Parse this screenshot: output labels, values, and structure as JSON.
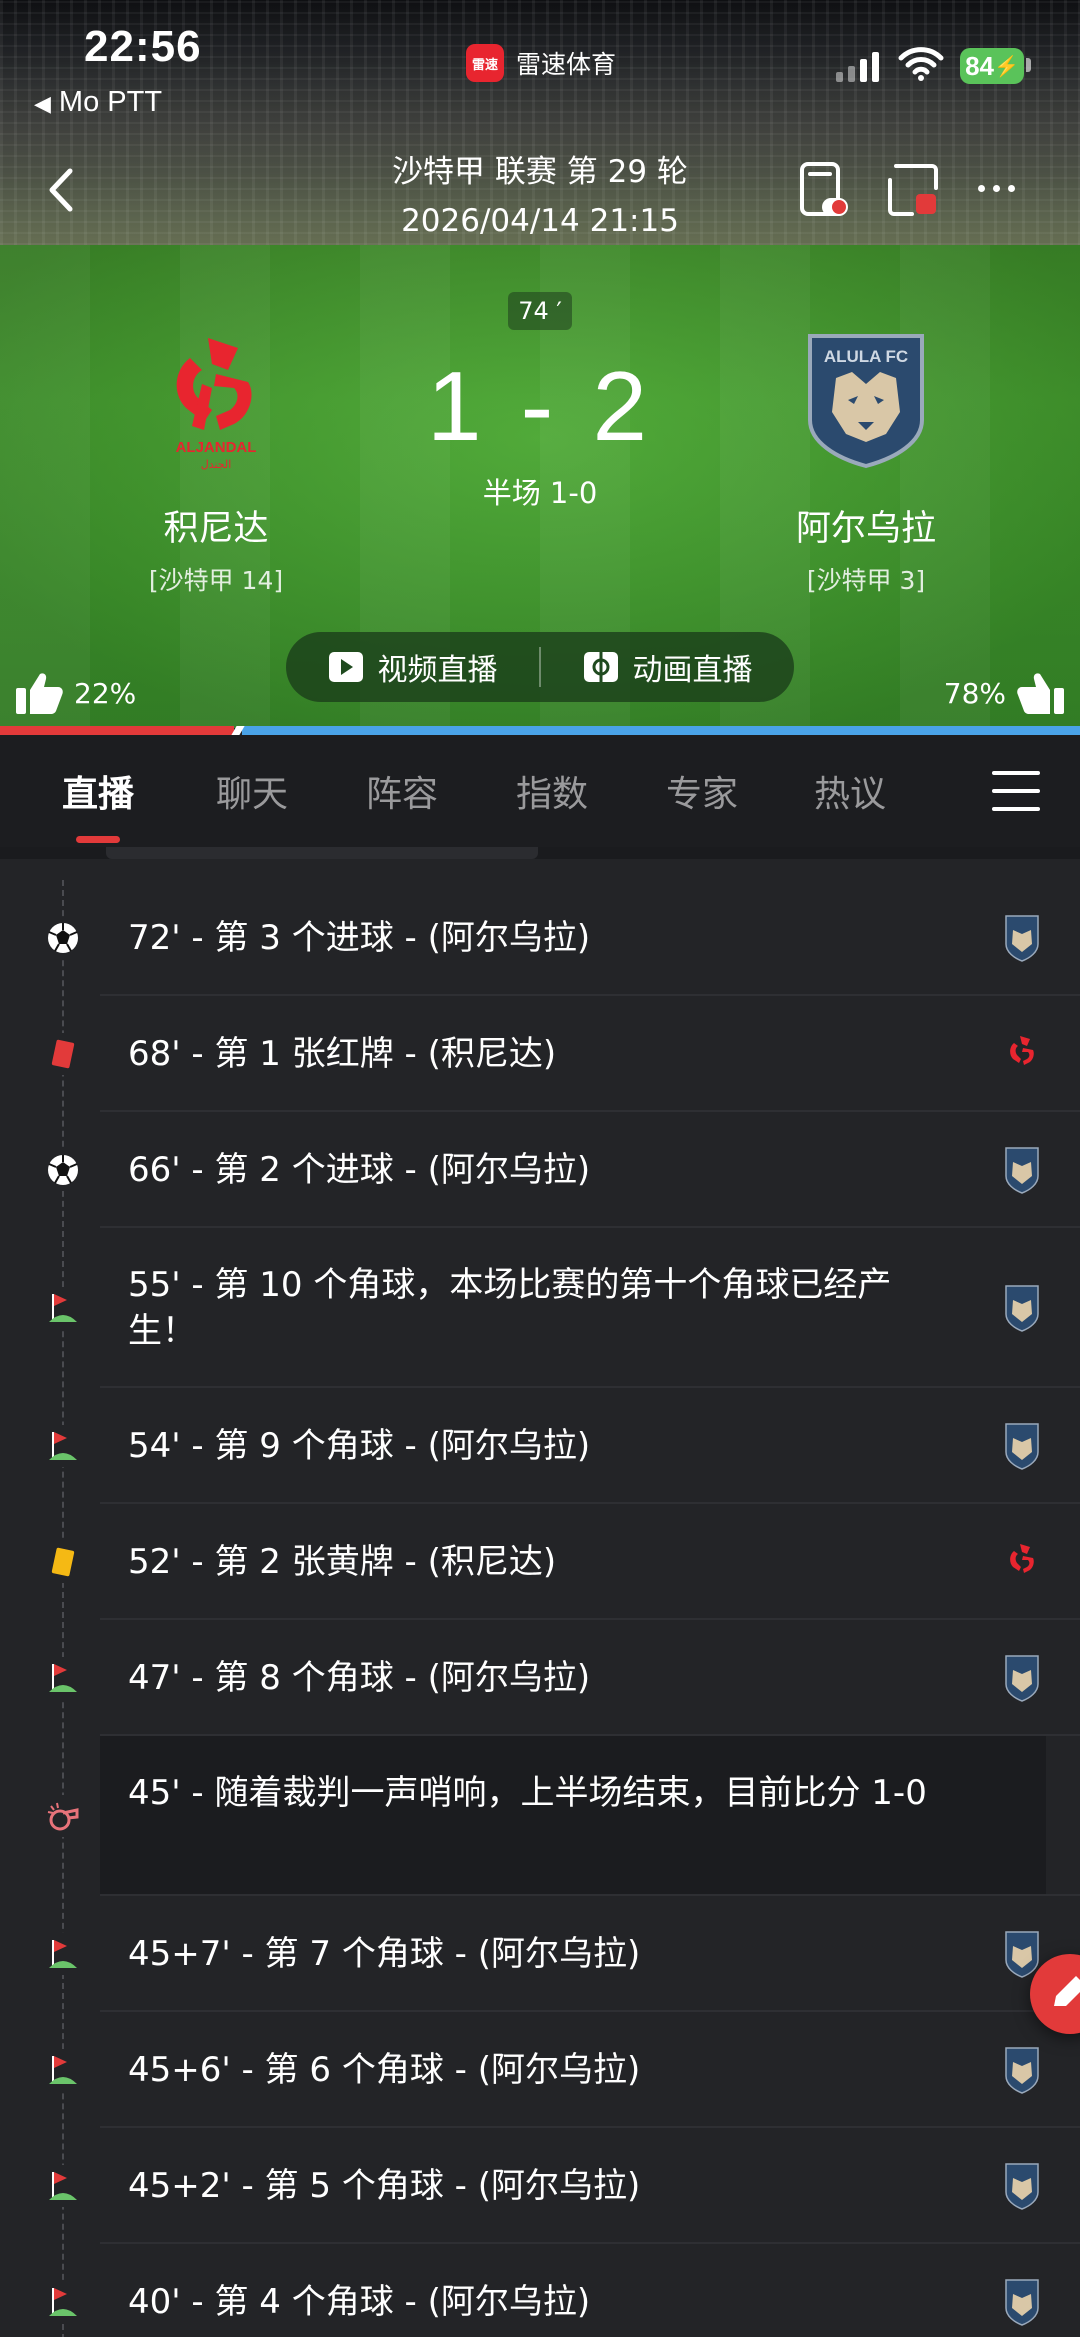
{
  "status": {
    "time": "22:56",
    "back_app": "Mo PTT",
    "app_name": "雷速体育",
    "app_logo_text": "雷速",
    "battery": "84"
  },
  "header": {
    "league_round": "沙特甲 联赛 第 29 轮",
    "datetime": "2026/04/14 21:15",
    "minute": "74 ′",
    "score": "1 - 2",
    "halftime": "半场 1-0"
  },
  "home": {
    "name": "积尼达",
    "rank": "[沙特甲 14]",
    "logo_text": "ALJANDAL",
    "color": "#e8252f",
    "vote_pct": "22%",
    "vote_fraction": 0.22
  },
  "away": {
    "name": "阿尔乌拉",
    "rank": "[沙特甲 3]",
    "logo_text": "ALULA FC",
    "color": "#2b4a6e",
    "vote_pct": "78%"
  },
  "live": {
    "video_label": "视频直播",
    "animation_label": "动画直播"
  },
  "tabs": [
    "直播",
    "聊天",
    "阵容",
    "指数",
    "专家",
    "热议"
  ],
  "events": [
    {
      "type": "goal",
      "text": "72' - 第 3 个进球 - (阿尔乌拉)",
      "team": "away",
      "lines": 1
    },
    {
      "type": "red-card",
      "text": "68' - 第 1 张红牌 - (积尼达)",
      "team": "home",
      "lines": 1
    },
    {
      "type": "goal",
      "text": "66' - 第 2 个进球 - (阿尔乌拉)",
      "team": "away",
      "lines": 1
    },
    {
      "type": "corner",
      "text": "55' - 第 10 个角球，本场比赛的第十个角球已经产生！",
      "team": "away",
      "lines": 2
    },
    {
      "type": "corner",
      "text": "54' - 第 9 个角球 - (阿尔乌拉)",
      "team": "away",
      "lines": 1
    },
    {
      "type": "yellow-card",
      "text": "52' - 第 2 张黄牌 - (积尼达)",
      "team": "home",
      "lines": 1
    },
    {
      "type": "corner",
      "text": "47' - 第 8 个角球 - (阿尔乌拉)",
      "team": "away",
      "lines": 1
    },
    {
      "type": "whistle",
      "text": "45' - 随着裁判一声哨响，上半场结束，目前比分 1-0",
      "team": "",
      "lines": 2,
      "highlight": true
    },
    {
      "type": "corner",
      "text": "45+7' - 第 7 个角球 - (阿尔乌拉)",
      "team": "away",
      "lines": 1
    },
    {
      "type": "corner",
      "text": "45+6' - 第 6 个角球 - (阿尔乌拉)",
      "team": "away",
      "lines": 1
    },
    {
      "type": "corner",
      "text": "45+2' - 第 5 个角球 - (阿尔乌拉)",
      "team": "away",
      "lines": 1
    },
    {
      "type": "corner",
      "text": "40' - 第 4 个角球 - (阿尔乌拉)",
      "team": "away",
      "lines": 1
    }
  ]
}
